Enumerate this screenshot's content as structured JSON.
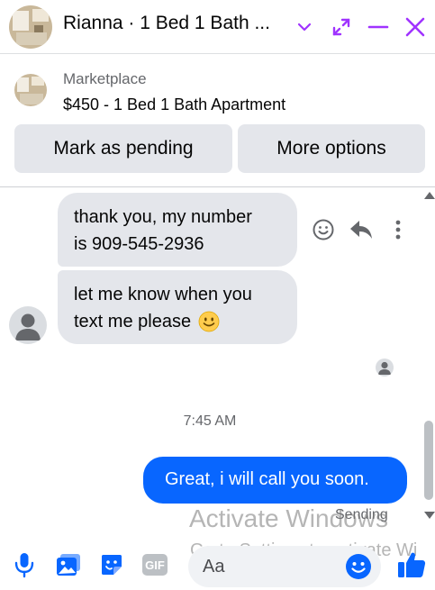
{
  "header": {
    "title": "Rianna · 1 Bed 1 Bath ..."
  },
  "product": {
    "source": "Marketplace",
    "title": "$450 - 1 Bed 1 Bath Apartment",
    "mark_pending_label": "Mark as pending",
    "more_options_label": "More options"
  },
  "messages": [
    {
      "direction": "in",
      "text_line1": "thank you, my number",
      "text_line2": "is 909-545-2936"
    },
    {
      "direction": "in",
      "text_line1": "let me know when you",
      "text_line2": "text me please"
    },
    {
      "direction": "out",
      "text": "Great, i will call you soon."
    }
  ],
  "timestamp": "7:45 AM",
  "status": "Sending",
  "watermark": {
    "line1": "Activate Windows",
    "line2": "Go to Settings to activate Wi"
  },
  "composer": {
    "placeholder": "Aa",
    "gif_label": "GIF"
  },
  "colors": {
    "accent": "#a033ff",
    "messenger_blue": "#0866ff",
    "icon_blue": "#0866ff",
    "bubble_gray": "#e4e6eb"
  },
  "icons": [
    "minimize-icon",
    "expand-icon",
    "chevron-down-icon",
    "close-icon",
    "emoji-react-icon",
    "reply-icon",
    "more-dots-icon",
    "mic-icon",
    "photo-icon",
    "sticker-icon",
    "gif-icon",
    "emoji-icon",
    "like-icon"
  ]
}
